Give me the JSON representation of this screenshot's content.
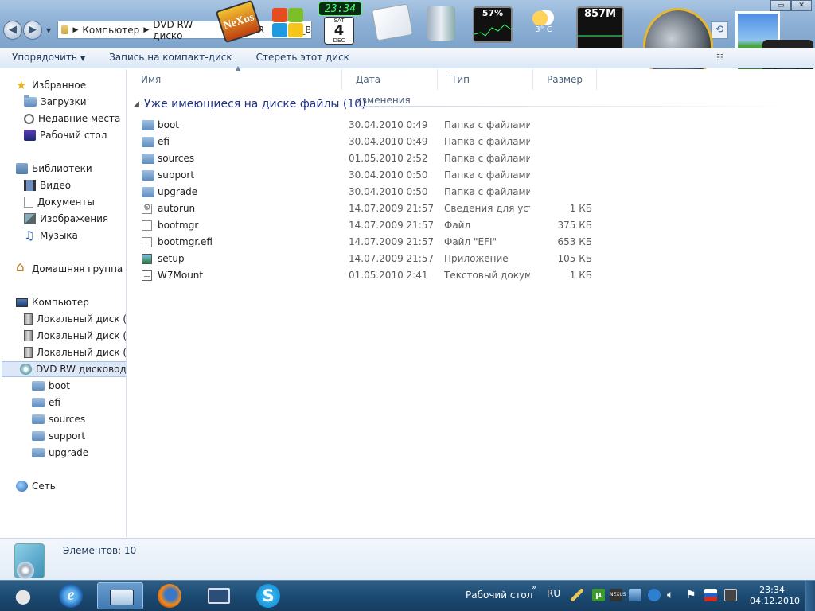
{
  "window": {
    "controls": [
      "▭",
      "✕"
    ]
  },
  "address": {
    "crumbs": [
      "Компьютер",
      "DVD RW диско"
    ],
    "overlap_text": "GR",
    "overlap_text2": "ER_B"
  },
  "gadgets": {
    "nexus": "NeXus",
    "clock_time": "23:34",
    "cal_day": "SAT",
    "cal_date": "4",
    "cal_month": "DEC",
    "cpu": "57%",
    "weather_temp": "3° C",
    "ram": "857M"
  },
  "toolbar": {
    "organize": "Упорядочить",
    "burn": "Запись на компакт-диск",
    "erase": "Стереть этот диск"
  },
  "navpane": {
    "favorites": "Избранное",
    "downloads": "Загрузки",
    "recent": "Недавние места",
    "desktop": "Рабочий стол",
    "libraries": "Библиотеки",
    "video": "Видео",
    "documents": "Документы",
    "images": "Изображения",
    "music": "Музыка",
    "homegroup": "Домашняя группа",
    "computer": "Компьютер",
    "drive_c": "Локальный диск (C",
    "drive_d": "Локальный диск (D",
    "drive_e": "Локальный диск (E:",
    "dvd": "DVD RW дисковод (",
    "sub_folders": [
      "boot",
      "efi",
      "sources",
      "support",
      "upgrade"
    ],
    "network": "Сеть"
  },
  "columns": {
    "name": "Имя",
    "date": "Дата изменения",
    "type": "Тип",
    "size": "Размер"
  },
  "group": {
    "title": "Уже имеющиеся на диске файлы (10)"
  },
  "files": [
    {
      "name": "boot",
      "date": "30.04.2010 0:49",
      "type": "Папка с файлами",
      "size": "",
      "icon": "folder-icon"
    },
    {
      "name": "efi",
      "date": "30.04.2010 0:49",
      "type": "Папка с файлами",
      "size": "",
      "icon": "folder-icon"
    },
    {
      "name": "sources",
      "date": "01.05.2010 2:52",
      "type": "Папка с файлами",
      "size": "",
      "icon": "folder-icon"
    },
    {
      "name": "support",
      "date": "30.04.2010 0:50",
      "type": "Папка с файлами",
      "size": "",
      "icon": "folder-icon"
    },
    {
      "name": "upgrade",
      "date": "30.04.2010 0:50",
      "type": "Папка с файлами",
      "size": "",
      "icon": "folder-icon"
    },
    {
      "name": "autorun",
      "date": "14.07.2009 21:57",
      "type": "Сведения для уст...",
      "size": "1 КБ",
      "icon": "autorun-icon"
    },
    {
      "name": "bootmgr",
      "date": "14.07.2009 21:57",
      "type": "Файл",
      "size": "375 КБ",
      "icon": "file-icon"
    },
    {
      "name": "bootmgr.efi",
      "date": "14.07.2009 21:57",
      "type": "Файл \"EFI\"",
      "size": "653 КБ",
      "icon": "file-icon"
    },
    {
      "name": "setup",
      "date": "14.07.2009 21:57",
      "type": "Приложение",
      "size": "105 КБ",
      "icon": "setup-icon"
    },
    {
      "name": "W7Mount",
      "date": "01.05.2010 2:41",
      "type": "Текстовый докум...",
      "size": "1 КБ",
      "icon": "text-file-icon"
    }
  ],
  "details": {
    "count": "Элементов: 10"
  },
  "taskbar": {
    "desktop_label": "Рабочий стол",
    "lang": "RU",
    "time": "23:34",
    "date": "04.12.2010",
    "tray_utorrent": "µ",
    "tray_nexus": "NEXUS",
    "ie_letter": "e",
    "skype_letter": "S"
  }
}
